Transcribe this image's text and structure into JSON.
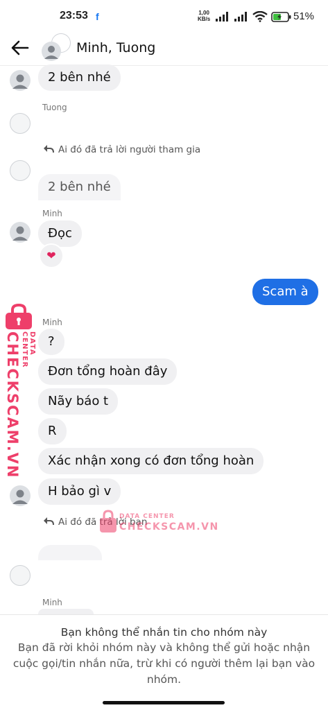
{
  "status_bar": {
    "time": "23:53",
    "app_icon": "f",
    "net_speed_value": "1,00",
    "net_speed_unit": "KB/s",
    "battery": "51%"
  },
  "header": {
    "title": "Minh, Tuong"
  },
  "messages": {
    "m1": "2 bên nhé",
    "sender_tuong": "Tuong",
    "reply_note_1": "Ai đó đã trả lời người tham gia",
    "m2": "2 bên nhé",
    "sender_minh_1": "Minh",
    "m3": "Đọc",
    "reaction": "❤",
    "mine_1": "Scam à",
    "sender_minh_2": "Minh",
    "m4": "?",
    "m5": "Đơn tổng hoàn đây",
    "m6": "Nãy báo t",
    "m7": "R",
    "m8": "Xác nhận xong có đơn tổng hoàn",
    "m9": "H bảo gì v",
    "reply_note_2": "Ai đó đã trả lời bạn",
    "sender_minh_3": "Minh"
  },
  "watermark": {
    "brand": "CHECKSCAM.VN",
    "sub": "DATA CENTER"
  },
  "footer": {
    "title": "Bạn không thể nhắn tin cho nhóm này",
    "body": "Bạn đã rời khỏi nhóm này và không thể gửi hoặc nhận cuộc gọi/tin nhắn nữa, trừ khi có người thêm lại bạn vào nhóm."
  },
  "colors": {
    "my_bubble": "#1f6fe5",
    "other_bubble": "#f0f0f2",
    "watermark": "#ee3f6a"
  }
}
